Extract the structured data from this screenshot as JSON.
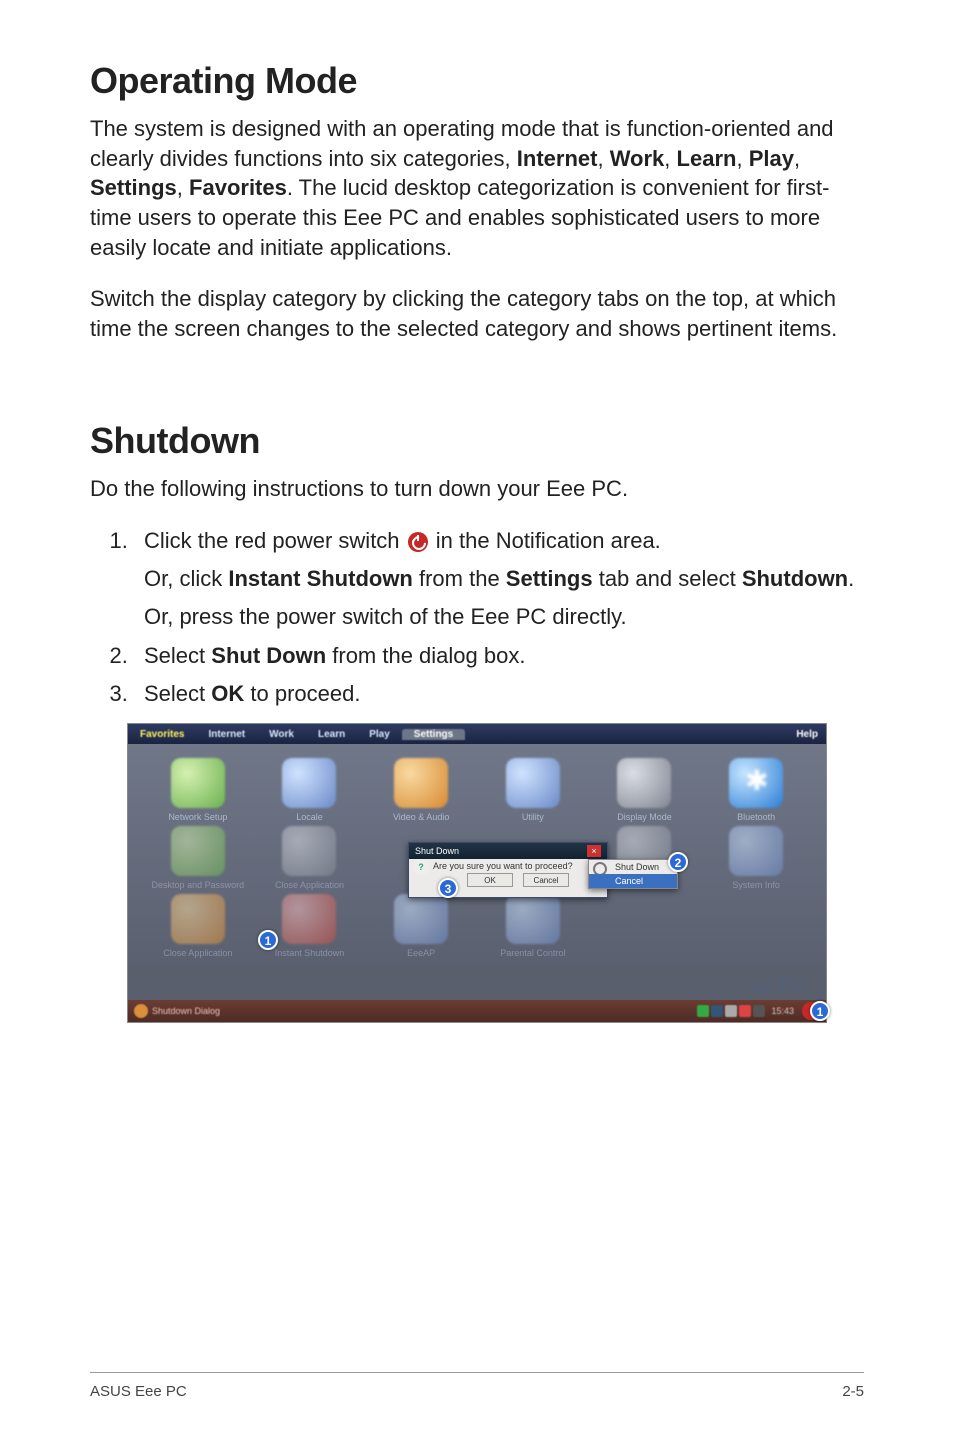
{
  "section1": {
    "heading": "Operating Mode",
    "para1_parts": [
      "The system is designed with an operating mode that is function-oriented and clearly divides functions into six categories, ",
      "Internet",
      ", ",
      "Work",
      ", ",
      "Learn",
      ", ",
      "Play",
      ", ",
      "Settings",
      ", ",
      "Favorites",
      ". The lucid desktop categorization is convenient for first-time users to operate this Eee PC and enables sophisticated users to more easily locate and initiate applications."
    ],
    "para2": "Switch the display category by clicking the category tabs on the top, at which time the screen changes to the selected category and shows pertinent items."
  },
  "section2": {
    "heading": "Shutdown",
    "intro": "Do the following instructions to turn down your Eee PC.",
    "steps": {
      "s1a_pre": "Click the red power switch ",
      "s1a_post": " in the Notification area.",
      "s1b_1": "Or, click ",
      "s1b_bold1": "Instant Shutdown",
      "s1b_2": " from the ",
      "s1b_bold2": "Settings",
      "s1b_3": " tab and select ",
      "s1b_bold3": "Shutdown",
      "s1b_4": ".",
      "s1c": "Or, press the power switch of the Eee PC directly.",
      "s2_1": "Select ",
      "s2_bold": "Shut Down",
      "s2_2": " from the dialog box.",
      "s3_1": "Select ",
      "s3_bold": "OK",
      "s3_2": " to proceed."
    }
  },
  "mock": {
    "tabs": [
      "Favorites",
      "Internet",
      "Work",
      "Learn",
      "Play",
      "Settings"
    ],
    "help": "Help",
    "row1": [
      "Network Setup",
      "Locale",
      "Video & Audio",
      "Utility",
      "Display Mode",
      "Bluetooth"
    ],
    "row2": [
      "Desktop and Password",
      "Close Application",
      "",
      "",
      "Shut Down",
      "System Info"
    ],
    "row3": [
      "Close Application",
      "Instant Shutdown",
      "EeeAP",
      "Parental Control"
    ],
    "dialog": {
      "title": "Shut Down",
      "msg": "Are you sure you want to proceed?",
      "ok": "OK",
      "cancel": "Cancel"
    },
    "menu": {
      "shutdown": "Shut Down",
      "cancel": "Cancel"
    },
    "brand": "ee PC",
    "taskbar_left": "Shutdown Dialog",
    "clock": "15:43",
    "markers": {
      "m1": "1",
      "m2": "2",
      "m3": "3",
      "m1b": "1"
    }
  },
  "footer": {
    "left": "ASUS Eee PC",
    "right": "2-5"
  }
}
